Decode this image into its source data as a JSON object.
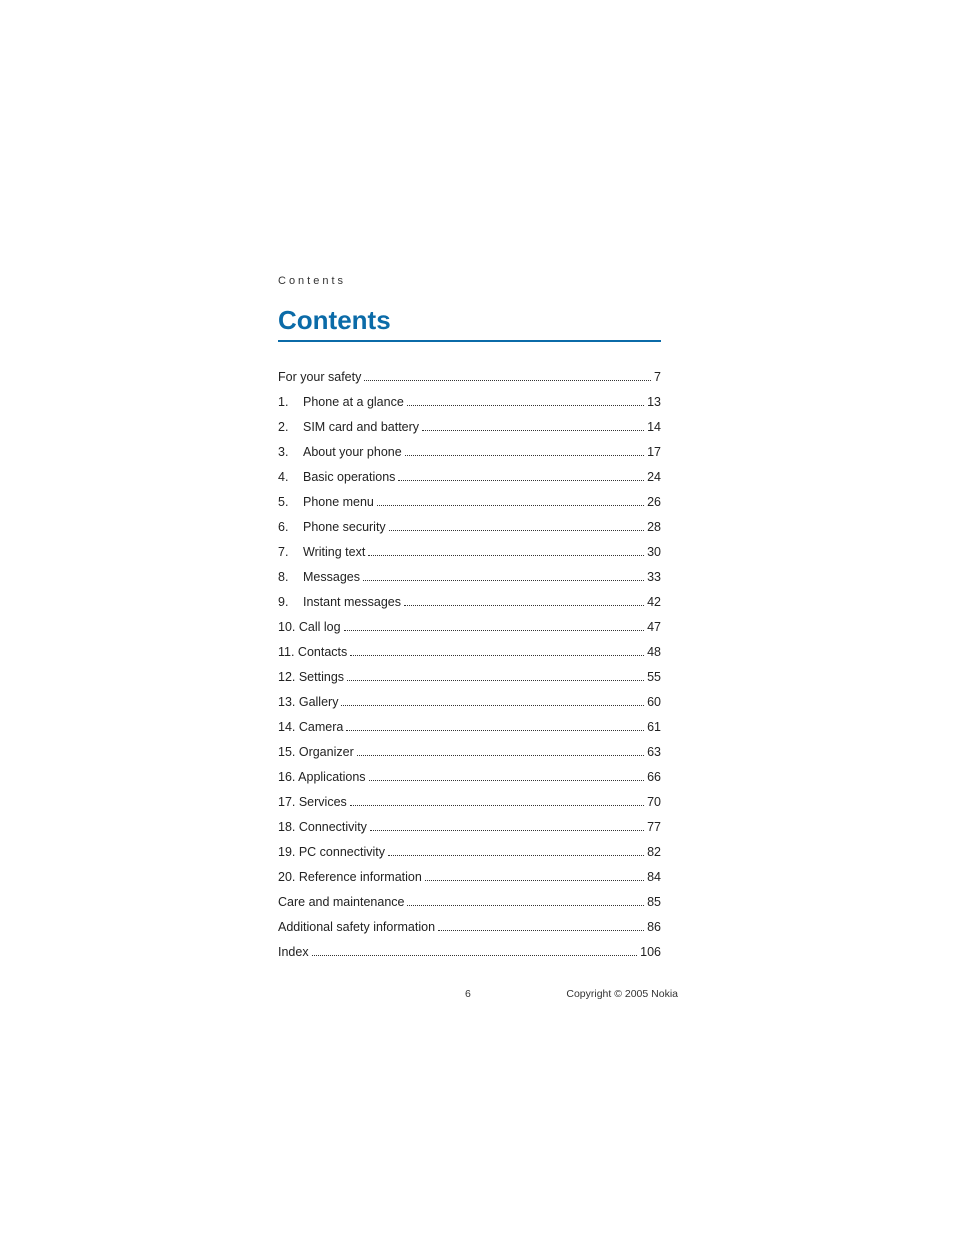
{
  "header_small": "Contents",
  "title": "Contents",
  "toc": [
    {
      "num": "",
      "label": "For your safety",
      "page": "7"
    },
    {
      "num": "1.",
      "label": "Phone at a glance",
      "page": "13"
    },
    {
      "num": "2.",
      "label": "SIM card and battery",
      "page": "14"
    },
    {
      "num": "3.",
      "label": "About your phone",
      "page": "17"
    },
    {
      "num": "4.",
      "label": "Basic operations",
      "page": "24"
    },
    {
      "num": "5.",
      "label": "Phone menu",
      "page": "26"
    },
    {
      "num": "6.",
      "label": "Phone security",
      "page": "28"
    },
    {
      "num": "7.",
      "label": "Writing text",
      "page": "30"
    },
    {
      "num": "8.",
      "label": "Messages",
      "page": "33"
    },
    {
      "num": "9.",
      "label": "Instant messages",
      "page": "42"
    },
    {
      "num": "10.",
      "label": "Call log",
      "page": "47"
    },
    {
      "num": "11.",
      "label": "Contacts",
      "page": "48"
    },
    {
      "num": "12.",
      "label": "Settings",
      "page": "55"
    },
    {
      "num": "13.",
      "label": "Gallery",
      "page": "60"
    },
    {
      "num": "14.",
      "label": "Camera",
      "page": "61"
    },
    {
      "num": "15.",
      "label": "Organizer",
      "page": "63"
    },
    {
      "num": "16.",
      "label": "Applications",
      "page": "66"
    },
    {
      "num": "17.",
      "label": "Services",
      "page": "70"
    },
    {
      "num": "18.",
      "label": "Connectivity",
      "page": "77"
    },
    {
      "num": "19.",
      "label": "PC connectivity",
      "page": "82"
    },
    {
      "num": "20.",
      "label": "Reference information",
      "page": "84"
    },
    {
      "num": "",
      "label": "Care and maintenance",
      "page": "85"
    },
    {
      "num": "",
      "label": "Additional safety information",
      "page": "86"
    },
    {
      "num": "",
      "label": "Index",
      "page": "106"
    }
  ],
  "footer": {
    "page_number": "6",
    "copyright": "Copyright © 2005 Nokia"
  }
}
